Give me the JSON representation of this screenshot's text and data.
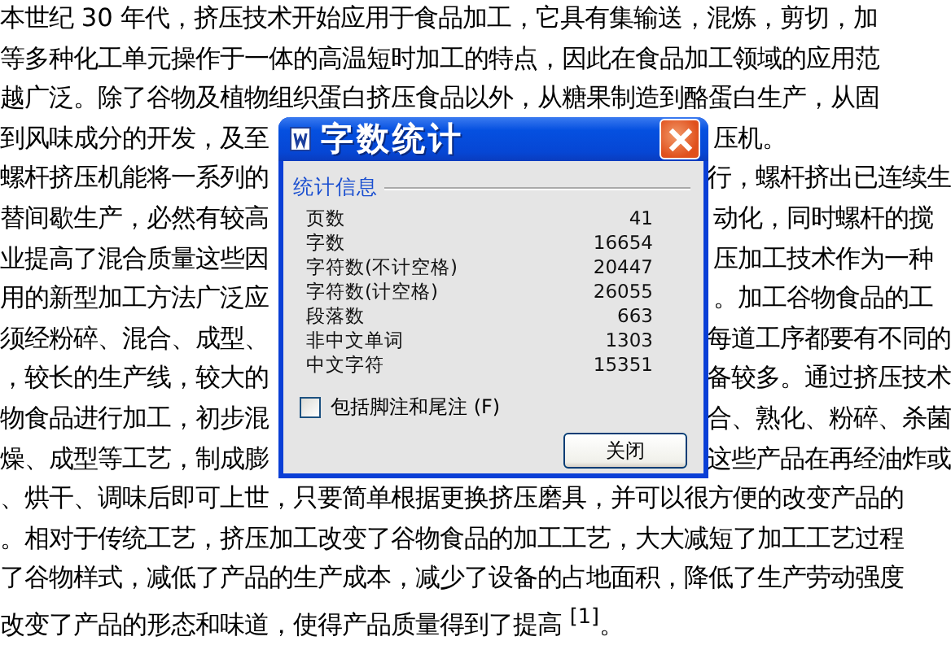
{
  "document": {
    "lines": [
      {
        "kind": "full",
        "text": "本世纪 30 年代，挤压技术开始应用于食品加工，它具有集输送，混炼，剪切，加"
      },
      {
        "kind": "full",
        "text": "等多种化工单元操作于一体的高温短时加工的特点，因此在食品加工领域的应用范"
      },
      {
        "kind": "full",
        "text": "越广泛。除了谷物及植物组织蛋白挤压食品以外，从糖果制造到酪蛋白生产，从固"
      },
      {
        "kind": "split",
        "left": "到风味成分的开发，及至",
        "right": "压机。"
      },
      {
        "kind": "split",
        "left": "螺杆挤压机能将一系列的",
        "right": "行，螺杆挤出已连续生"
      },
      {
        "kind": "split",
        "left": "替间歇生产，必然有较高",
        "right": "动化，同时螺杆的搅"
      },
      {
        "kind": "split",
        "left": "业提高了混合质量这些因",
        "right": "压加工技术作为一种"
      },
      {
        "kind": "split",
        "left": "用的新型加工方法广泛应",
        "right": "。加工谷物食品的工"
      },
      {
        "kind": "split",
        "left": "须经粉碎、混合、成型、",
        "right": "每道工序都要有不同的"
      },
      {
        "kind": "split",
        "left": "，较长的生产线，较大的",
        "right": "备较多。通过挤压技术"
      },
      {
        "kind": "split",
        "left": "物食品进行加工，初步混",
        "right": "合、熟化、粉碎、杀菌"
      },
      {
        "kind": "split",
        "left": "燥、成型等工艺，制成膨",
        "right": "这些产品在再经油炸或"
      },
      {
        "kind": "full",
        "text": "、烘干、调味后即可上世，只要简单根据更换挤压磨具，并可以很方便的改变产品的"
      },
      {
        "kind": "full",
        "text": "。相对于传统工艺，挤压加工改变了谷物食品的加工工艺，大大减短了加工工艺过程"
      },
      {
        "kind": "full",
        "text": "了谷物样式，减低了产品的生产成本，减少了设备的占地面积，降低了生产劳动强度"
      },
      {
        "kind": "full",
        "text": "改变了产品的形态和味道，使得产品质量得到了提高 $^{[1]}$。"
      }
    ]
  },
  "dialog": {
    "title": "字数统计",
    "group": "统计信息",
    "stats": [
      {
        "label": "页数",
        "value": "41"
      },
      {
        "label": "字数",
        "value": "16654"
      },
      {
        "label": "字符数(不计空格)",
        "value": "20447"
      },
      {
        "label": "字符数(计空格)",
        "value": "26055"
      },
      {
        "label": "段落数",
        "value": "663"
      },
      {
        "label": "非中文单词",
        "value": "1303"
      },
      {
        "label": "中文字符",
        "value": "15351"
      }
    ],
    "checkbox": {
      "label": "包括脚注和尾注 (F)",
      "checked": false
    },
    "buttons": [
      "关闭"
    ]
  }
}
